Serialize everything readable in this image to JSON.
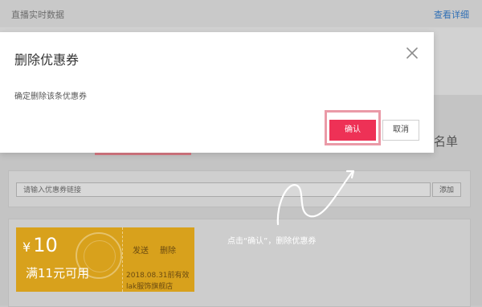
{
  "background": {
    "live_title": "直播实时数据",
    "detail_link": "查看详细",
    "right_text": "名单",
    "coupon_input_placeholder": "请输入优惠券链接",
    "add_button": "添加"
  },
  "coupon": {
    "currency": "¥",
    "amount": "10",
    "condition": "满11元可用",
    "send": "发送",
    "delete": "删除",
    "expiry": "2018.08.31前有效",
    "shop": "lak服饰旗舰店"
  },
  "modal": {
    "title": "删除优惠券",
    "message": "确定删除该条优惠券",
    "confirm": "确认",
    "cancel": "取消"
  },
  "annotation": {
    "hint": "点击“确认”，删除优惠券"
  },
  "colors": {
    "confirm": "#ee3156",
    "highlight": "#ea9aa7",
    "coupon": "#d8a11c",
    "link": "#2f6fb5"
  },
  "icons": {
    "close": "close-icon",
    "arrow": "arrow-annotation-icon"
  }
}
